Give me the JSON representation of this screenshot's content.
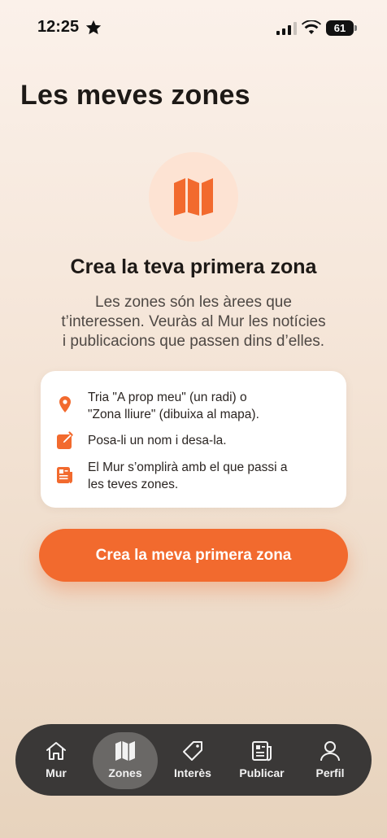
{
  "status_bar": {
    "time": "12:25",
    "battery": "61"
  },
  "page": {
    "title": "Les meves zones"
  },
  "empty_state": {
    "icon": "map-icon",
    "title": "Crea la teva primera zona",
    "description_lines": [
      "Les zones són les àrees que",
      "t’interessen. Veuràs al Mur les notícies",
      "i publicacions que passen dins d’elles."
    ]
  },
  "steps": [
    {
      "icon": "location-pin-icon",
      "lines": [
        "Tria \"A prop meu\" (un radi) o",
        "\"Zona lliure\" (dibuixa al mapa)."
      ]
    },
    {
      "icon": "edit-icon",
      "lines": [
        "Posa-li un nom i desa-la."
      ]
    },
    {
      "icon": "newspaper-icon",
      "lines": [
        "El Mur s’omplirà amb el que passi a",
        "les teves zones."
      ]
    }
  ],
  "cta": {
    "label": "Crea la meva primera zona"
  },
  "tab_bar": {
    "active": "Zones",
    "items": [
      {
        "label": "Mur",
        "icon": "home-icon"
      },
      {
        "label": "Zones",
        "icon": "map-icon"
      },
      {
        "label": "Interès",
        "icon": "tag-icon"
      },
      {
        "label": "Publicar",
        "icon": "newspaper-icon"
      },
      {
        "label": "Perfil",
        "icon": "user-icon"
      }
    ]
  },
  "colors": {
    "accent": "#f26a2e",
    "accent_soft": "#fde3d3",
    "tab_bar": "#3a3837"
  }
}
